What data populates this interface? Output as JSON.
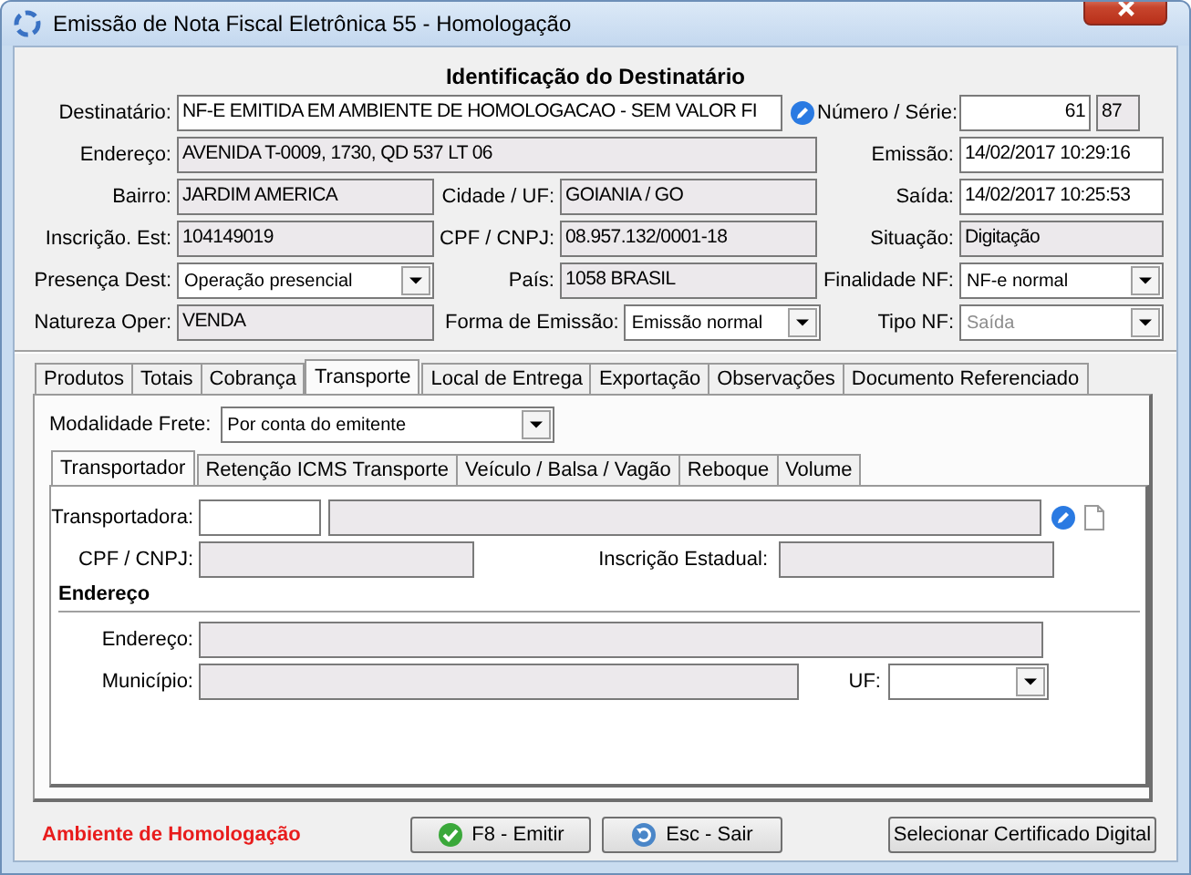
{
  "window": {
    "title": "Emissão de Nota Fiscal Eletrônica 55 - Homologação"
  },
  "header": {
    "title": "Identificação do Destinatário",
    "destinatario": {
      "label": "Destinatário:",
      "value": "NF-E EMITIDA EM AMBIENTE DE HOMOLOGACAO - SEM VALOR FI",
      "readonly": false
    },
    "numero_serie": {
      "label": "Número / Série:",
      "numero": "61",
      "serie": "87"
    },
    "endereco": {
      "label": "Endereço:",
      "value": "AVENIDA T-0009, 1730, QD 537 LT 06",
      "readonly": true
    },
    "emissao": {
      "label": "Emissão:",
      "value": "14/02/2017 10:29:16",
      "readonly": false
    },
    "bairro": {
      "label": "Bairro:",
      "value": "JARDIM AMERICA",
      "readonly": true
    },
    "cidade_uf": {
      "label": "Cidade / UF:",
      "value": "GOIANIA / GO",
      "readonly": true
    },
    "saida": {
      "label": "Saída:",
      "value": "14/02/2017 10:25:53",
      "readonly": false
    },
    "inscricao_est": {
      "label": "Inscrição. Est:",
      "value": "104149019",
      "readonly": true
    },
    "cpf_cnpj": {
      "label": "CPF / CNPJ:",
      "value": "08.957.132/0001-18",
      "readonly": true
    },
    "situacao": {
      "label": "Situação:",
      "value": "Digitação",
      "readonly": true
    },
    "presenca_dest": {
      "label": "Presença Dest:",
      "value": "Operação presencial",
      "disabled": false
    },
    "pais": {
      "label": "País:",
      "value": "1058 BRASIL",
      "readonly": true
    },
    "finalidade_nf": {
      "label": "Finalidade NF:",
      "value": "NF-e normal",
      "disabled": false
    },
    "natureza_oper": {
      "label": "Natureza Oper:",
      "value": "VENDA",
      "readonly": true
    },
    "forma_emissao": {
      "label": "Forma de Emissão:",
      "value": "Emissão normal",
      "disabled": false
    },
    "tipo_nf": {
      "label": "Tipo NF:",
      "value": "Saída",
      "disabled": true
    }
  },
  "tabs": [
    {
      "label": "Produtos",
      "selected": false
    },
    {
      "label": "Totais",
      "selected": false
    },
    {
      "label": "Cobrança",
      "selected": false
    },
    {
      "label": "Transporte",
      "selected": true
    },
    {
      "label": "Local de Entrega",
      "selected": false
    },
    {
      "label": "Exportação",
      "selected": false
    },
    {
      "label": "Observações",
      "selected": false
    },
    {
      "label": "Documento Referenciado",
      "selected": false
    }
  ],
  "modalidade_frete": {
    "label": "Modalidade Frete:",
    "value": "Por conta do emitente",
    "disabled": false
  },
  "subtabs": [
    {
      "label": "Transportador",
      "selected": true
    },
    {
      "label": "Retenção ICMS Transporte",
      "selected": false
    },
    {
      "label": "Veículo / Balsa / Vagão",
      "selected": false
    },
    {
      "label": "Reboque",
      "selected": false
    },
    {
      "label": "Volume",
      "selected": false
    }
  ],
  "transportador": {
    "transportadora_label": "Transportadora:",
    "cpf_cnpj_label": "CPF / CNPJ:",
    "inscricao_estadual_label": "Inscrição Estadual:",
    "endereco_heading": "Endereço",
    "endereco_label": "Endereço:",
    "municipio_label": "Município:",
    "uf_label": "UF:"
  },
  "ambiente": "Ambiente de Homologação",
  "buttons": [
    {
      "label": "F8 - Emitir",
      "kind": "emit"
    },
    {
      "label": "Esc - Sair",
      "kind": "exit"
    },
    {
      "label": "Selecionar Certificado Digital",
      "kind": "plain"
    }
  ]
}
